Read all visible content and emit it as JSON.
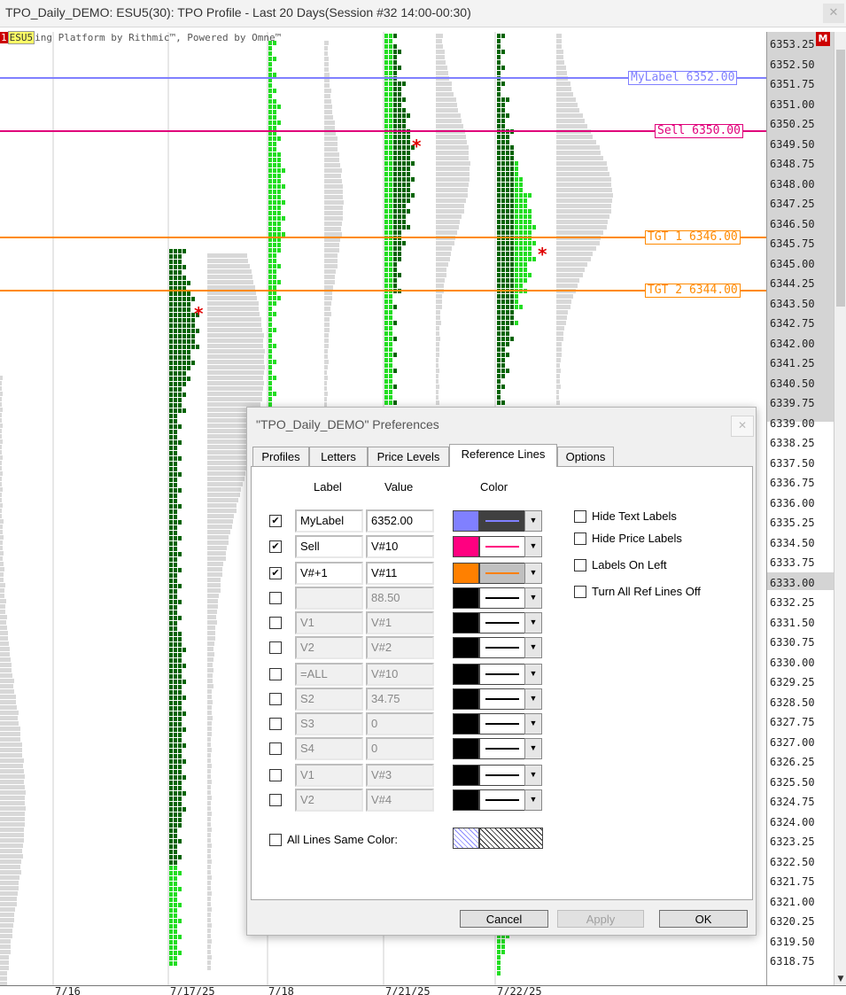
{
  "window": {
    "title": "TPO_Daily_DEMO: ESU5(30): TPO Profile - Last 20 Days(Session #32 14:00-00:30)",
    "close_glyph": "✕"
  },
  "chart": {
    "banner_prefix": "1",
    "banner_symbol": "ESU5",
    "banner_text": "ing Platform by Rithmic™, Powered by Omne™",
    "badge": "M",
    "price_ticks": [
      "6353.25",
      "6352.50",
      "6351.75",
      "6351.00",
      "6350.25",
      "6349.50",
      "6348.75",
      "6348.00",
      "6347.25",
      "6346.50",
      "6345.75",
      "6345.00",
      "6344.25",
      "6343.50",
      "6342.75",
      "6342.00",
      "6341.25",
      "6340.50",
      "6339.75",
      "6339.00",
      "6338.25",
      "6337.50",
      "6336.75",
      "6336.00",
      "6335.25",
      "6334.50",
      "6333.75",
      "6333.00",
      "6332.25",
      "6331.50",
      "6330.75",
      "6330.00",
      "6329.25",
      "6328.50",
      "6327.75",
      "6327.00",
      "6326.25",
      "6325.50",
      "6324.75",
      "6324.00",
      "6323.25",
      "6322.50",
      "6321.75",
      "6321.00",
      "6320.25",
      "6319.50",
      "6318.75"
    ],
    "date_labels": [
      "7/16",
      "7/17/25",
      "7/18",
      "7/21/25",
      "7/22/25"
    ],
    "ref_lines": [
      {
        "text": "MyLabel 6352.00",
        "color": "#8080ff"
      },
      {
        "text": "Sell 6350.00",
        "color": "#e0007a"
      },
      {
        "text": "TGT 1 6346.00",
        "color": "#ff8a00"
      },
      {
        "text": "TGT 2 6344.00",
        "color": "#ff8a00"
      }
    ],
    "colors": {
      "dark_green": "#006400",
      "light_green": "#22dd22",
      "gray": "#d8d8d8"
    }
  },
  "dialog": {
    "title": "\"TPO_Daily_DEMO\" Preferences",
    "close_glyph": "✕",
    "tabs": [
      "Profiles",
      "Letters",
      "Price Levels",
      "Reference Lines",
      "Options"
    ],
    "active_tab": "Reference Lines",
    "col_label": "Label",
    "col_value": "Value",
    "col_color": "Color",
    "rows": [
      {
        "label": "MyLabel",
        "value": "6352.00",
        "checked": true,
        "color": "#8080ff",
        "line": "#8080ff",
        "bg": "#404040"
      },
      {
        "label": "Sell",
        "value": "V#10",
        "checked": true,
        "color": "#ff0080",
        "line": "#ff0080",
        "bg": "#ffffff"
      },
      {
        "label": "V#+1",
        "value": "V#11",
        "checked": true,
        "color": "#ff8000",
        "line": "#ff8000",
        "bg": "#c0c0c0"
      },
      {
        "label": "",
        "value": "88.50",
        "checked": false,
        "color": "#000000",
        "line": "#000000",
        "bg": "#ffffff"
      },
      {
        "label": "V1",
        "value": "V#1",
        "checked": false,
        "color": "#000000",
        "line": "#000000",
        "bg": "#ffffff"
      },
      {
        "label": "V2",
        "value": "V#2",
        "checked": false,
        "color": "#000000",
        "line": "#000000",
        "bg": "#ffffff"
      },
      {
        "label": "=ALL",
        "value": "V#10",
        "checked": false,
        "color": "#000000",
        "line": "#000000",
        "bg": "#ffffff"
      },
      {
        "label": "S2",
        "value": "34.75",
        "checked": false,
        "color": "#000000",
        "line": "#000000",
        "bg": "#ffffff"
      },
      {
        "label": "S3",
        "value": "0",
        "checked": false,
        "color": "#000000",
        "line": "#000000",
        "bg": "#ffffff"
      },
      {
        "label": "S4",
        "value": "0",
        "checked": false,
        "color": "#000000",
        "line": "#000000",
        "bg": "#ffffff"
      },
      {
        "label": "V1",
        "value": "V#3",
        "checked": false,
        "color": "#000000",
        "line": "#000000",
        "bg": "#ffffff"
      },
      {
        "label": "V2",
        "value": "V#4",
        "checked": false,
        "color": "#000000",
        "line": "#000000",
        "bg": "#ffffff"
      }
    ],
    "options": [
      "Hide Text Labels",
      "Hide Price Labels",
      "Labels On Left",
      "Turn All Ref Lines Off"
    ],
    "all_lines_same_color": "All Lines Same Color:",
    "dropdown_glyph": "▼",
    "buttons": {
      "cancel": "Cancel",
      "apply": "Apply",
      "ok": "OK"
    }
  }
}
